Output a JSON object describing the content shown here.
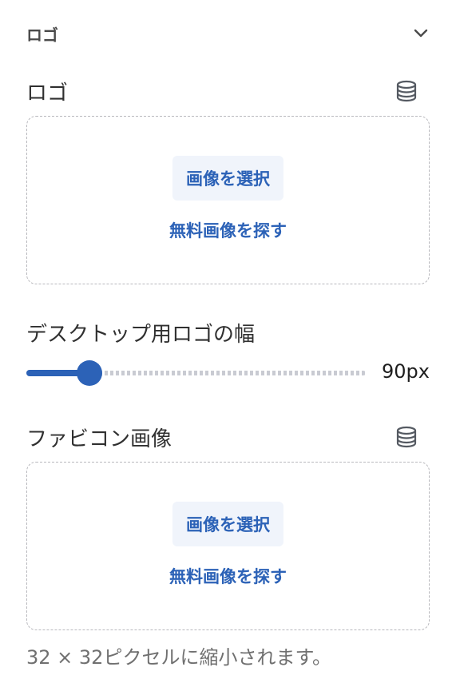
{
  "section": {
    "title": "ロゴ",
    "toggle_icon": "chevron-down-icon"
  },
  "logo": {
    "label": "ロゴ",
    "source_icon": "database-icon",
    "select_button": "画像を選択",
    "free_images_link": "無料画像を探す"
  },
  "logo_width": {
    "label": "デスクトップ用ロゴの幅",
    "value_text": "90px",
    "level_fraction": 0.185
  },
  "favicon": {
    "label": "ファビコン画像",
    "source_icon": "database-icon",
    "select_button": "画像を選択",
    "free_images_link": "無料画像を探す",
    "help_text": "32 × 32ピクセルに縮小されます。"
  },
  "colors": {
    "accent": "#2c62b7",
    "button_bg": "#f0f4fb",
    "border": "#b8b8bd"
  }
}
